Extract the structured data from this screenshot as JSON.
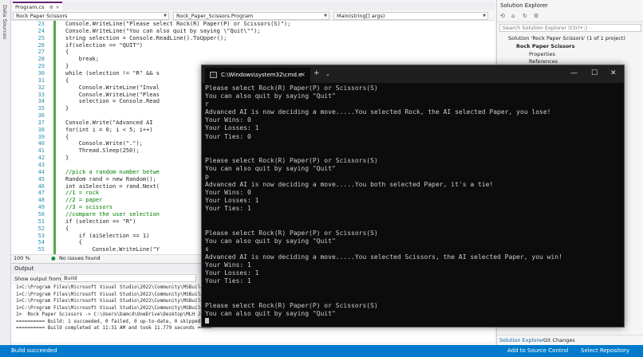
{
  "left_sidebar": {
    "label": "Data Sources"
  },
  "editor": {
    "tab": {
      "label": "Program.cs",
      "pin": "⊕",
      "close": "×"
    },
    "nav": {
      "project": "Rock Paper Scissors",
      "class": "Rock_Paper_Scissors.Program",
      "member": "Main(string[] args)"
    },
    "lines": [
      {
        "n": "23",
        "t": "Console.WriteLine(\"Please select Rock(R) Paper(P) or Scissors(S)\");",
        "i": 8
      },
      {
        "n": "24",
        "t": "Console.WriteLine(\"You can also quit by saying \\\"Quit\\\"\");",
        "i": 8
      },
      {
        "n": "25",
        "t": "string selection = Console.ReadLine().ToUpper();",
        "i": 8
      },
      {
        "n": "26",
        "t": "if(selection == \"QUIT\")",
        "i": 8
      },
      {
        "n": "27",
        "t": "{",
        "i": 8
      },
      {
        "n": "28",
        "t": "break;",
        "i": 12
      },
      {
        "n": "29",
        "t": "}",
        "i": 8
      },
      {
        "n": "30",
        "t": "while (selection != \"R\" && s",
        "i": 8
      },
      {
        "n": "31",
        "t": "{",
        "i": 8
      },
      {
        "n": "32",
        "t": "Console.WriteLine(\"Inval",
        "i": 12
      },
      {
        "n": "33",
        "t": "Console.WriteLine(\"Pleas",
        "i": 12
      },
      {
        "n": "34",
        "t": "selection = Console.Read",
        "i": 12
      },
      {
        "n": "35",
        "t": "}",
        "i": 8
      },
      {
        "n": "36",
        "t": "",
        "i": 8
      },
      {
        "n": "37",
        "t": "Console.Write(\"Advanced AI",
        "i": 8
      },
      {
        "n": "38",
        "t": "for(int i = 0; i < 5; i++)",
        "i": 8
      },
      {
        "n": "39",
        "t": "{",
        "i": 8
      },
      {
        "n": "40",
        "t": "Console.Write(\".\");",
        "i": 12
      },
      {
        "n": "41",
        "t": "Thread.Sleep(250);",
        "i": 12
      },
      {
        "n": "42",
        "t": "}",
        "i": 8
      },
      {
        "n": "43",
        "t": "",
        "i": 8
      },
      {
        "n": "44",
        "t": "//pick a random number betwe",
        "i": 8
      },
      {
        "n": "45",
        "t": "Random rand = new Random();",
        "i": 8
      },
      {
        "n": "46",
        "t": "int aiSelection = rand.Next(",
        "i": 8
      },
      {
        "n": "47",
        "t": "//1 = rock",
        "i": 8
      },
      {
        "n": "48",
        "t": "//2 = paper",
        "i": 8
      },
      {
        "n": "49",
        "t": "//3 = scissors",
        "i": 8
      },
      {
        "n": "50",
        "t": "//compare the user selection",
        "i": 8
      },
      {
        "n": "51",
        "t": "if (selection == \"R\")",
        "i": 8
      },
      {
        "n": "52",
        "t": "{",
        "i": 8
      },
      {
        "n": "53",
        "t": "if (aiSelection == 1)",
        "i": 12
      },
      {
        "n": "54",
        "t": "{",
        "i": 12
      },
      {
        "n": "55",
        "t": "Console.WriteLine(\"Y",
        "i": 16
      }
    ],
    "zoom": "100 %",
    "issues": "No issues found"
  },
  "output": {
    "title": "Output",
    "show_from_label": "Show output from:",
    "show_from_value": "Build",
    "lines": [
      "1>C:\\Program Files\\Microsoft Visual Studio\\2022\\Community\\MSBuild\\Cu",
      "1>C:\\Program Files\\Microsoft Visual Studio\\2022\\Community\\MSBuild\\Cu",
      "1>C:\\Program Files\\Microsoft Visual Studio\\2022\\Community\\MSBuild\\Cu",
      "1>C:\\Program Files\\Microsoft Visual Studio\\2022\\Community\\MSBuild\\Cu",
      "1>  Rock Paper Scissors -> C:\\Users\\bamcd\\OneDrive\\Desktop\\MLH Janu",
      "========== Build: 1 succeeded, 0 failed, 0 up-to-date, 0 skipped ===",
      "========== Build completed at 11:31 AM and took 11.779 seconds ====="
    ]
  },
  "status_bar": {
    "left": "Build succeeded",
    "add_source": "Add to Source Control",
    "select_repo": "Select Repository"
  },
  "solution_explorer": {
    "title": "Solution Explorer",
    "search_placeholder": "Search Solution Explorer (Ctrl+;)",
    "solution": "Solution 'Rock Paper Scissors' (1 of 1 project)",
    "project": "Rock Paper Scissors",
    "properties": "Properties",
    "references": "References",
    "tab_active": "Solution Explorer",
    "tab_other": "Git Changes"
  },
  "terminal": {
    "tab_title": "C:\\Windows\\system32\\cmd.e",
    "lines": [
      "Please select Rock(R) Paper(P) or Scissors(S)",
      "You can also quit by saying \"Quit\"",
      "r",
      "Advanced AI is now deciding a move.....You selected Rock, the AI selected Paper, you lose!",
      "Your Wins: 0",
      "Your Losses: 1",
      "Your Ties: 0",
      "",
      "",
      "Please select Rock(R) Paper(P) or Scissors(S)",
      "You can also quit by saying \"Quit\"",
      "p",
      "Advanced AI is now deciding a move.....You both selected Paper, it's a tie!",
      "Your Wins: 0",
      "Your Losses: 1",
      "Your Ties: 1",
      "",
      "",
      "Please select Rock(R) Paper(P) or Scissors(S)",
      "You can also quit by saying \"Quit\"",
      "s",
      "Advanced AI is now deciding a move.....You selected Scissors, the AI selected Paper, you win!",
      "Your Wins: 1",
      "Your Losses: 1",
      "Your Ties: 1",
      "",
      "",
      "Please select Rock(R) Paper(P) or Scissors(S)",
      "You can also quit by saying \"Quit\""
    ]
  }
}
